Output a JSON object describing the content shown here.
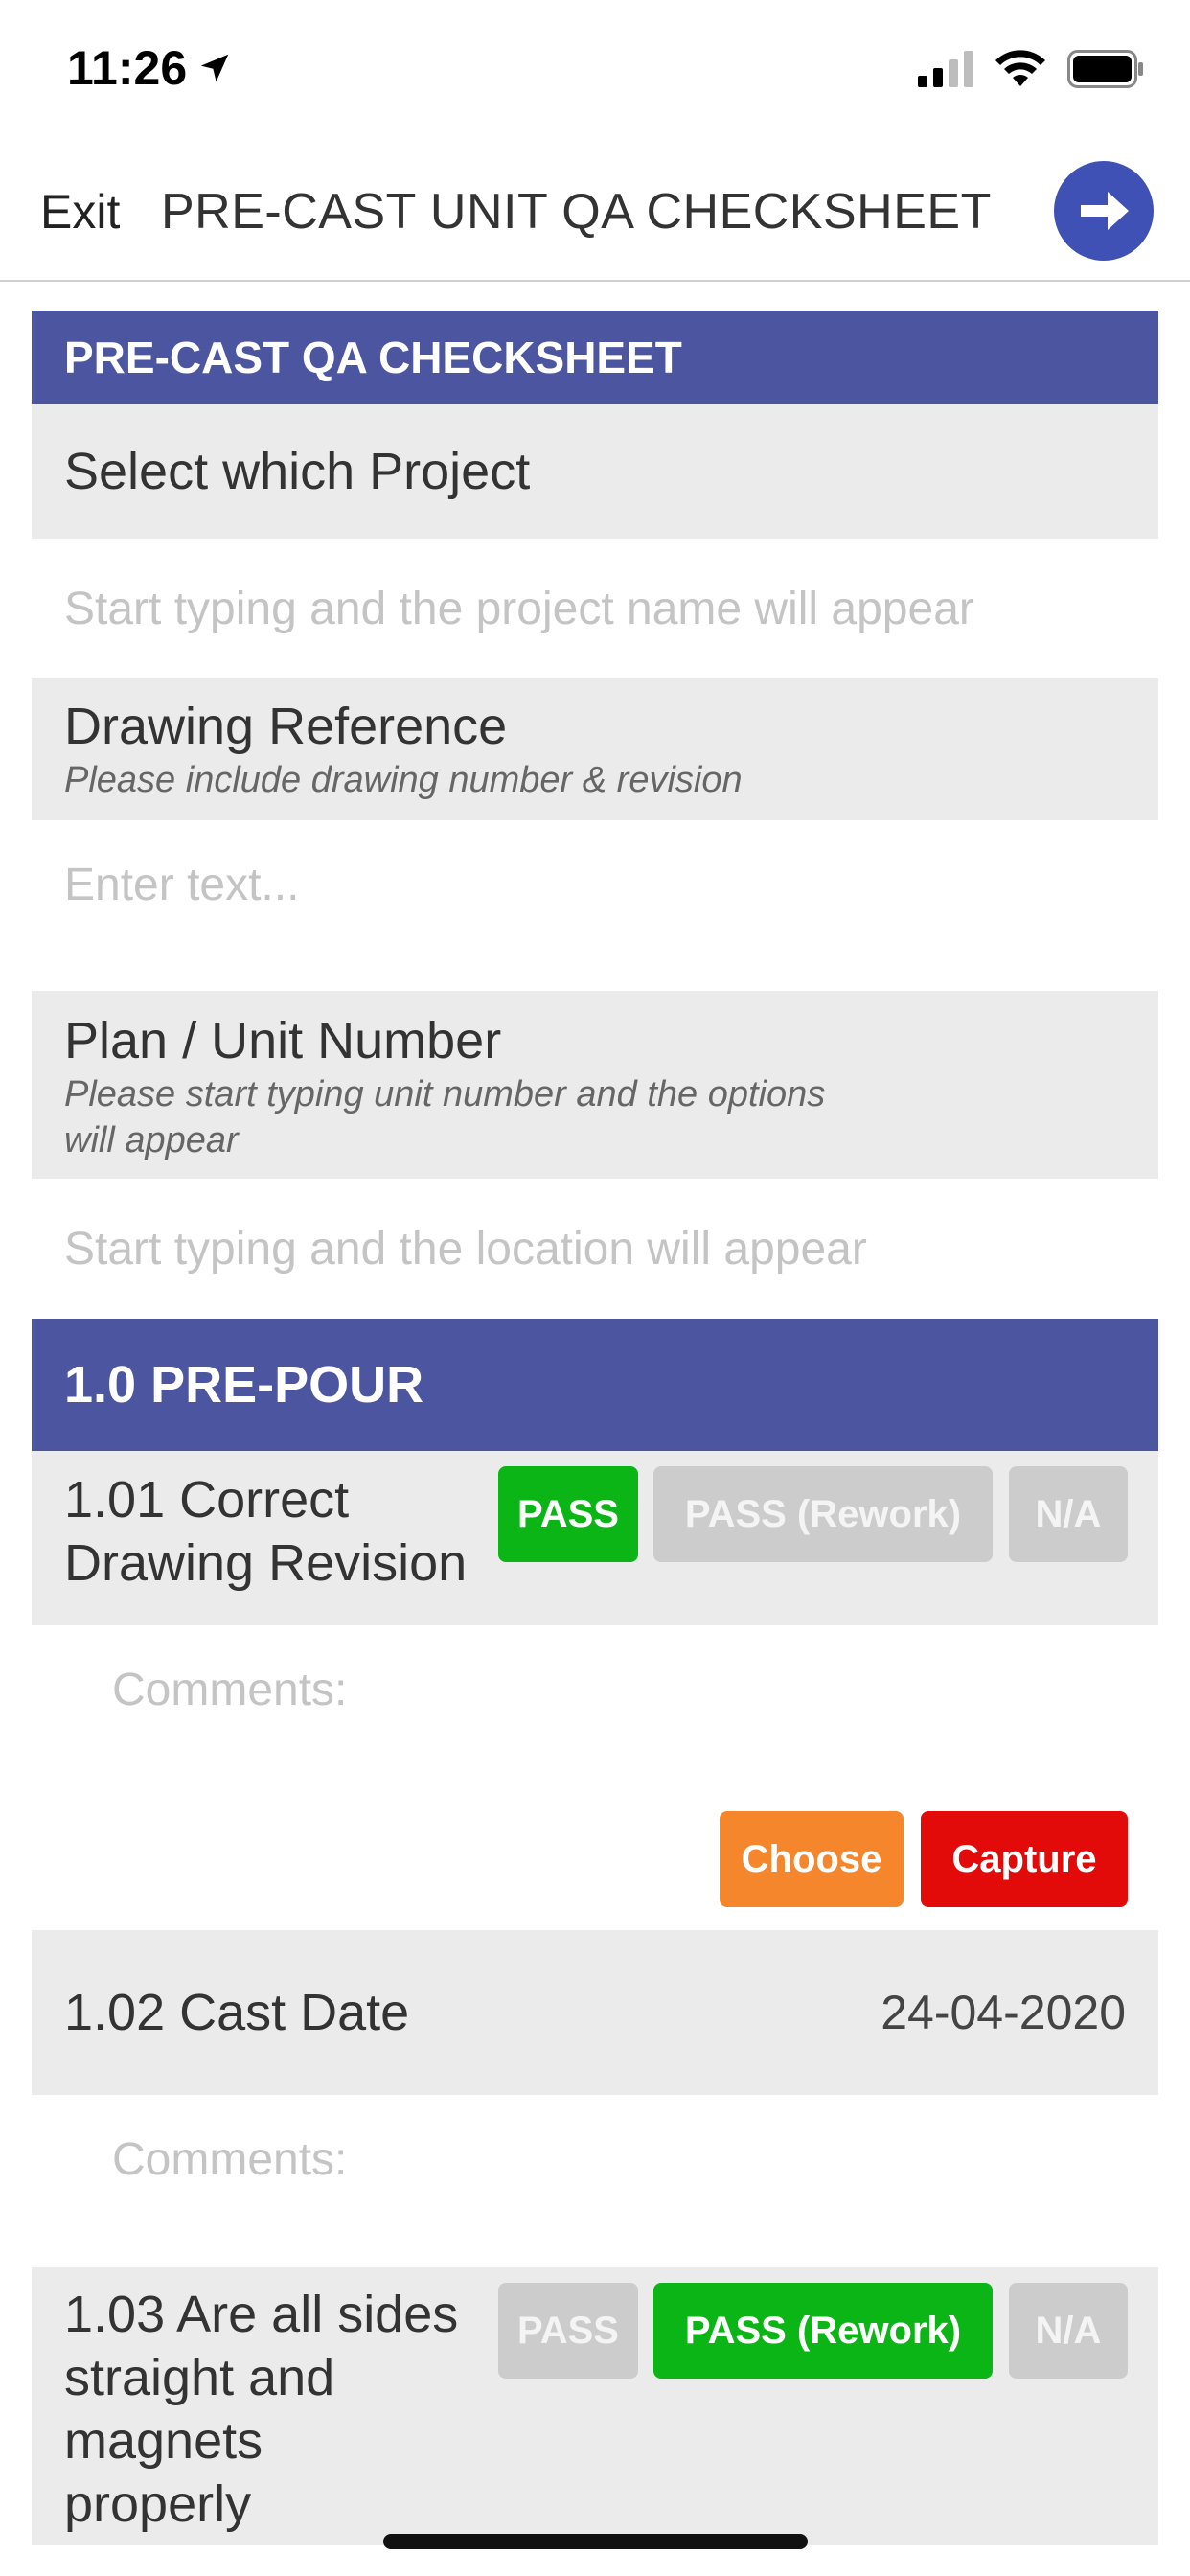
{
  "status_bar": {
    "time": "11:26"
  },
  "header": {
    "exit_label": "Exit",
    "title": "PRE-CAST UNIT QA CHECKSHEET",
    "next_icon": "arrow-right-icon"
  },
  "form": {
    "section_title": "PRE-CAST QA CHECKSHEET",
    "project": {
      "label": "Select which Project",
      "placeholder": "Start typing and the project name will appear"
    },
    "drawing": {
      "label": "Drawing Reference",
      "hint": "Please include drawing number & revision",
      "placeholder": "Enter text..."
    },
    "unit": {
      "label": "Plan / Unit Number",
      "hint_line1": "Please start typing unit number and the options",
      "hint_line2": "will appear",
      "placeholder": "Start typing and the location will appear"
    },
    "prepour": {
      "title": "1.0 PRE-POUR",
      "item1": {
        "label_line1": "1.01 Correct",
        "label_line2": "Drawing Revision",
        "selected": "PASS"
      },
      "item2": {
        "label": "1.02 Cast Date",
        "value": "24-04-2020"
      },
      "item3": {
        "label_line1": "1.03 Are all sides",
        "label_line2": "straight and",
        "label_line3": "magnets",
        "label_line4": "properly",
        "selected": "PASS (Rework)"
      },
      "comments_placeholder": "Comments:"
    },
    "options": {
      "pass": "PASS",
      "rework": "PASS (Rework)",
      "na": "N/A"
    },
    "attach": {
      "choose": "Choose",
      "capture": "Capture"
    }
  },
  "colors": {
    "section": "#4c56a0",
    "accent": "#3f51b5",
    "pass_selected": "#0cb516",
    "unselected": "#cccccc",
    "choose": "#f5862b",
    "capture": "#e30a0a"
  }
}
